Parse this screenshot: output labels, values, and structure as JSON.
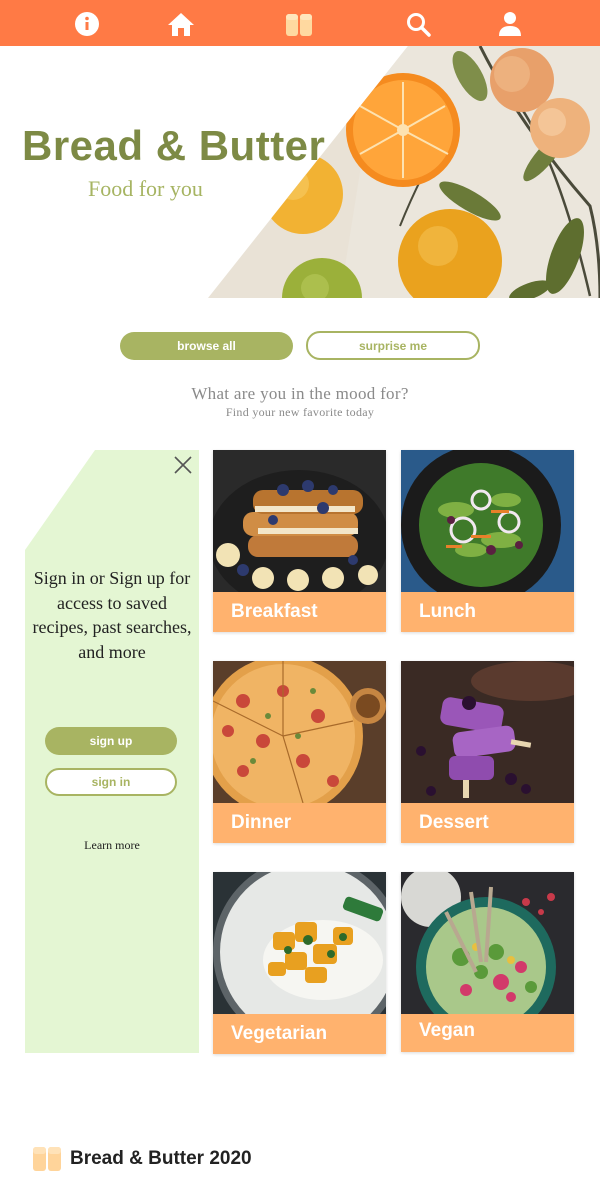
{
  "nav": {
    "icons": [
      "info-icon",
      "home-icon",
      "bread-icon",
      "search-icon",
      "user-icon"
    ],
    "bar_color": "#ff7a45"
  },
  "hero": {
    "title": "Bread & Butter",
    "subtitle": "Food for you",
    "title_color": "#7d8a45"
  },
  "actions": {
    "browse_label": "browse all",
    "surprise_label": "surprise me",
    "accent_color": "#a8b462"
  },
  "mood": {
    "title": "What are you in the mood for?",
    "subtitle": "Find your new favorite today"
  },
  "signin_panel": {
    "message": "Sign in or Sign up for access to saved recipes, past searches, and more",
    "signup_label": "sign up",
    "signin_label": "sign in",
    "learn_more": "Learn more",
    "bg_color": "#e4f6d3"
  },
  "categories": [
    {
      "label": "Breakfast"
    },
    {
      "label": "Lunch"
    },
    {
      "label": "Dinner"
    },
    {
      "label": "Dessert"
    },
    {
      "label": "Vegetarian"
    },
    {
      "label": "Vegan"
    }
  ],
  "card_label_color": "#ffb26e",
  "footer": {
    "text": "Bread & Butter 2020"
  }
}
